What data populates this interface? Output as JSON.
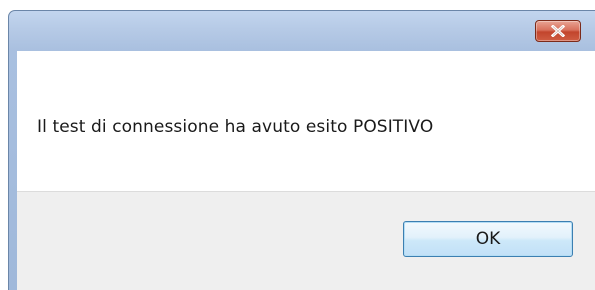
{
  "dialog": {
    "title": "",
    "message": "Il test di connessione ha avuto esito POSITIVO",
    "ok_label": "OK",
    "close_icon": "close-icon"
  },
  "colors": {
    "titlebar": "#b6cae6",
    "close_button": "#c94a32",
    "footer": "#efefef",
    "ok_border": "#3c7fb1"
  }
}
